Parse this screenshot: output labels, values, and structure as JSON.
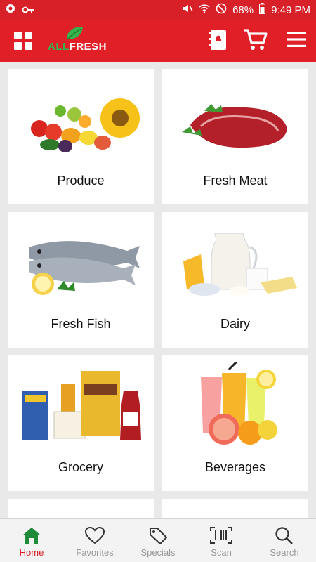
{
  "status": {
    "battery": "68%",
    "time": "9:49 PM"
  },
  "header": {
    "logo_prefix": "ALL",
    "logo_text": "FRESH"
  },
  "categories": [
    {
      "label": "Produce"
    },
    {
      "label": "Fresh Meat"
    },
    {
      "label": "Fresh Fish"
    },
    {
      "label": "Dairy"
    },
    {
      "label": "Grocery"
    },
    {
      "label": "Beverages"
    }
  ],
  "nav": [
    {
      "label": "Home",
      "active": true
    },
    {
      "label": "Favorites"
    },
    {
      "label": "Specials"
    },
    {
      "label": "Scan"
    },
    {
      "label": "Search"
    }
  ],
  "colors": {
    "brand_red": "#e01f27",
    "leaf_green": "#37b24d"
  },
  "icons": [
    "grid-menu-icon",
    "store-book-icon",
    "cart-icon",
    "hamburger-menu-icon",
    "home-icon",
    "heart-icon",
    "tag-icon",
    "barcode-icon",
    "search-icon"
  ]
}
